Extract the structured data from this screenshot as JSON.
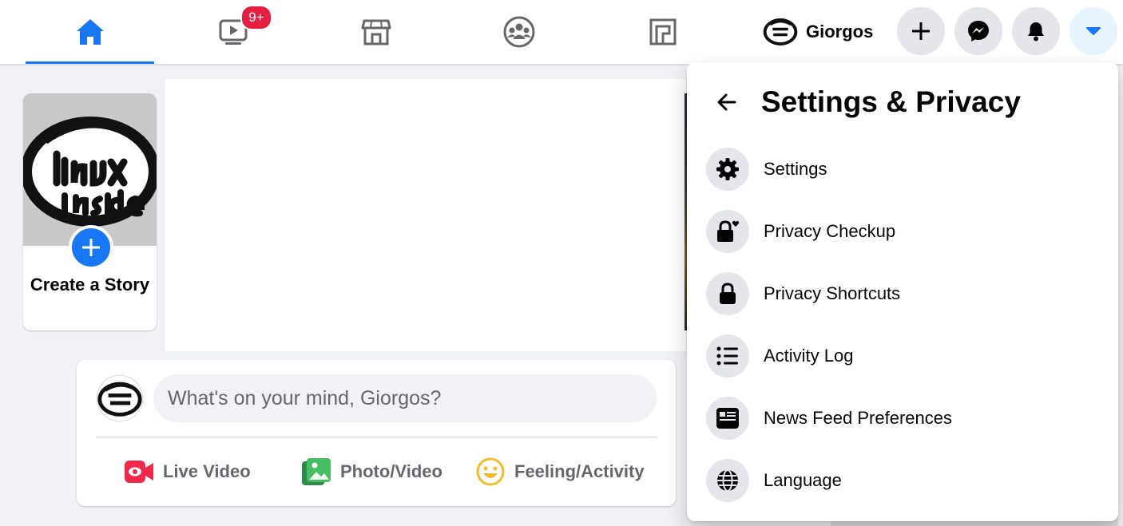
{
  "topbar": {
    "tabs": [
      {
        "icon": "home-icon",
        "active": true
      },
      {
        "icon": "watch-icon",
        "badge": "9+"
      },
      {
        "icon": "marketplace-icon"
      },
      {
        "icon": "groups-icon"
      },
      {
        "icon": "gaming-icon"
      }
    ],
    "profile_name": "Giorgos",
    "actions": [
      "create-icon",
      "messenger-icon",
      "notifications-icon",
      "account-menu-icon"
    ],
    "accent_color": "#1877f2",
    "badge_color": "#e41e3f"
  },
  "story": {
    "label": "Create a Story",
    "avatar_text": "linux inside"
  },
  "composer": {
    "placeholder": "What's on your mind, Giorgos?",
    "actions": [
      {
        "label": "Live Video",
        "icon": "live-video-icon",
        "color": "#f02849"
      },
      {
        "label": "Photo/Video",
        "icon": "photo-icon",
        "color": "#45bd62"
      },
      {
        "label": "Feeling/Activity",
        "icon": "feeling-icon",
        "color": "#f7b928"
      }
    ]
  },
  "dropdown": {
    "title": "Settings & Privacy",
    "items": [
      {
        "label": "Settings",
        "icon": "gear-icon"
      },
      {
        "label": "Privacy Checkup",
        "icon": "lock-heart-icon"
      },
      {
        "label": "Privacy Shortcuts",
        "icon": "lock-icon"
      },
      {
        "label": "Activity Log",
        "icon": "list-icon"
      },
      {
        "label": "News Feed Preferences",
        "icon": "news-feed-icon"
      },
      {
        "label": "Language",
        "icon": "globe-icon"
      }
    ]
  }
}
